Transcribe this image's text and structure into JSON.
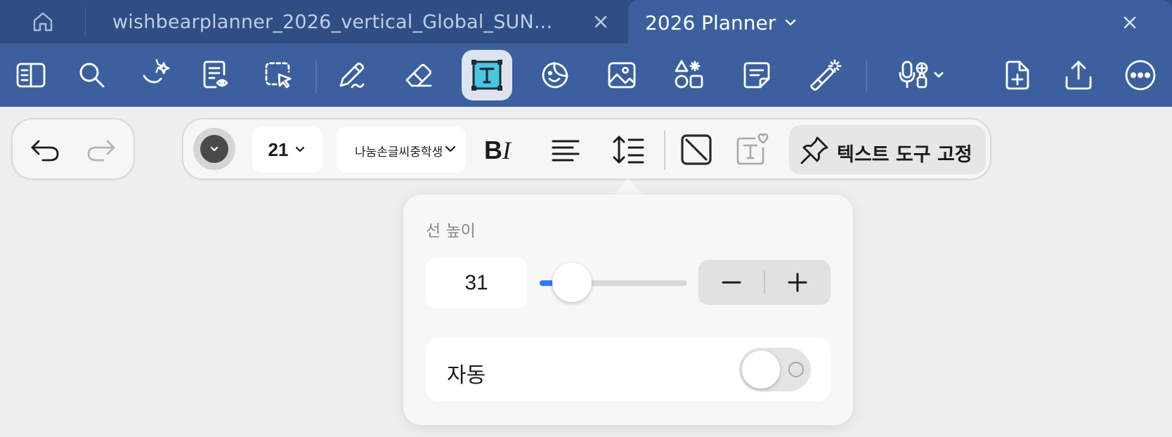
{
  "tabs": {
    "home_icon": "house-icon",
    "document_tab": {
      "title": "wishbearplanner_2026_vertical_Global_SUN...",
      "close_icon": "close-icon"
    },
    "active_tab": {
      "title": "2026 Planner",
      "chevron_icon": "chevron-down-icon",
      "close_icon": "close-icon"
    }
  },
  "toolbar": {
    "tools": [
      {
        "name": "sidebar-toggle-icon",
        "active": false
      },
      {
        "name": "search-icon",
        "active": false
      },
      {
        "name": "ai-sparkle-icon",
        "active": false
      },
      {
        "name": "read-mode-icon",
        "active": false
      },
      {
        "name": "lasso-select-icon",
        "active": false
      },
      {
        "name": "pen-icon",
        "active": false
      },
      {
        "name": "eraser-icon",
        "active": false
      },
      {
        "name": "text-tool-icon",
        "active": true
      },
      {
        "name": "sticker-icon",
        "active": false
      },
      {
        "name": "image-icon",
        "active": false
      },
      {
        "name": "shapes-icon",
        "active": false
      },
      {
        "name": "sticky-note-icon",
        "active": false
      },
      {
        "name": "laser-pointer-icon",
        "active": false
      },
      {
        "name": "voice-recording-icon",
        "active": false
      },
      {
        "name": "add-page-icon",
        "active": false
      },
      {
        "name": "share-icon",
        "active": false
      },
      {
        "name": "more-icon",
        "active": false
      }
    ],
    "accent_color": "#3c609e",
    "tab_bar_color": "#2f4e86"
  },
  "undo_redo": {
    "undo_icon": "undo-icon",
    "redo_icon": "redo-icon",
    "redo_enabled": false
  },
  "text_format": {
    "text_color": "#4a4a4a",
    "font_size": "21",
    "font_name": "나눔손글씨중학생",
    "bold_italic_icon": "bold-italic-icon",
    "align_icon": "align-left-icon",
    "line_height_icon": "line-height-icon",
    "background_icon": "text-background-none-icon",
    "text_style_icon": "text-favorite-style-icon",
    "pin_label": "텍스트 도구 고정",
    "pin_icon": "pin-icon"
  },
  "line_height_popover": {
    "title": "선 높이",
    "value": "31",
    "slider_fraction": 0.22,
    "accent": "#3478f6",
    "minus_icon": "minus-icon",
    "plus_icon": "plus-icon",
    "auto_label": "자동",
    "auto_enabled": false
  }
}
